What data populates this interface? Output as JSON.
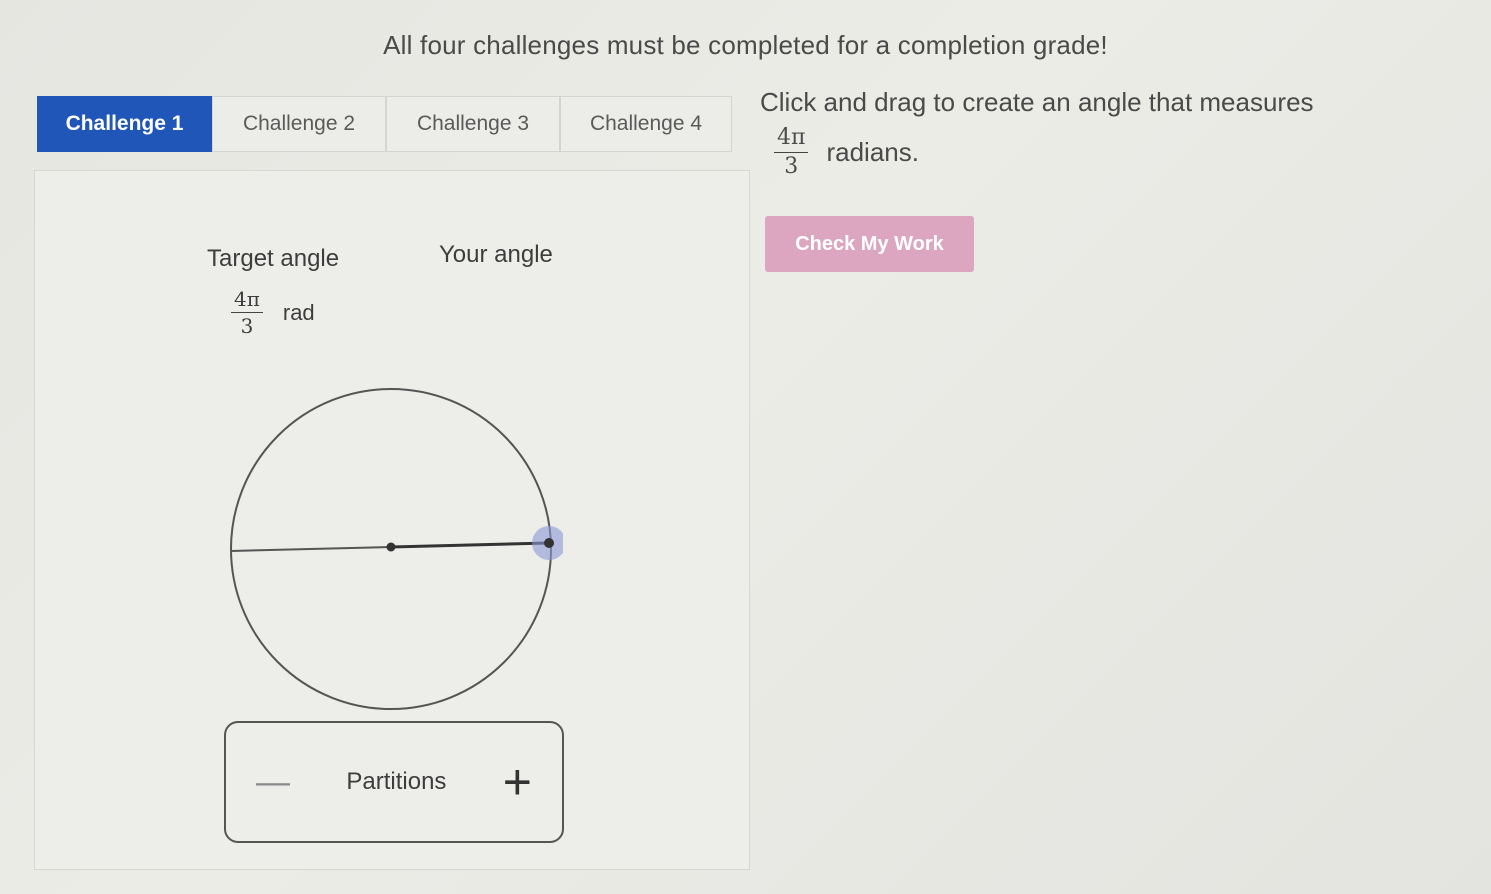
{
  "banner": "All four challenges must be completed for a completion grade!",
  "tabs": [
    {
      "label": "Challenge 1",
      "active": true
    },
    {
      "label": "Challenge 2",
      "active": false
    },
    {
      "label": "Challenge 3",
      "active": false
    },
    {
      "label": "Challenge 4",
      "active": false
    }
  ],
  "panel": {
    "target_label": "Target angle",
    "your_label": "Your angle",
    "target_num": "4π",
    "target_den": "3",
    "target_unit": "rad"
  },
  "partitions": {
    "minus": "—",
    "label": "Partitions",
    "plus": "+"
  },
  "instructions": {
    "text": "Click and drag to create an angle that measures",
    "num": "4π",
    "den": "3",
    "unit": "radians."
  },
  "check_button": "Check My Work",
  "colors": {
    "accent": "#1f56b8",
    "check_button": "#dca6c0",
    "handle": "#8b9ad6"
  }
}
